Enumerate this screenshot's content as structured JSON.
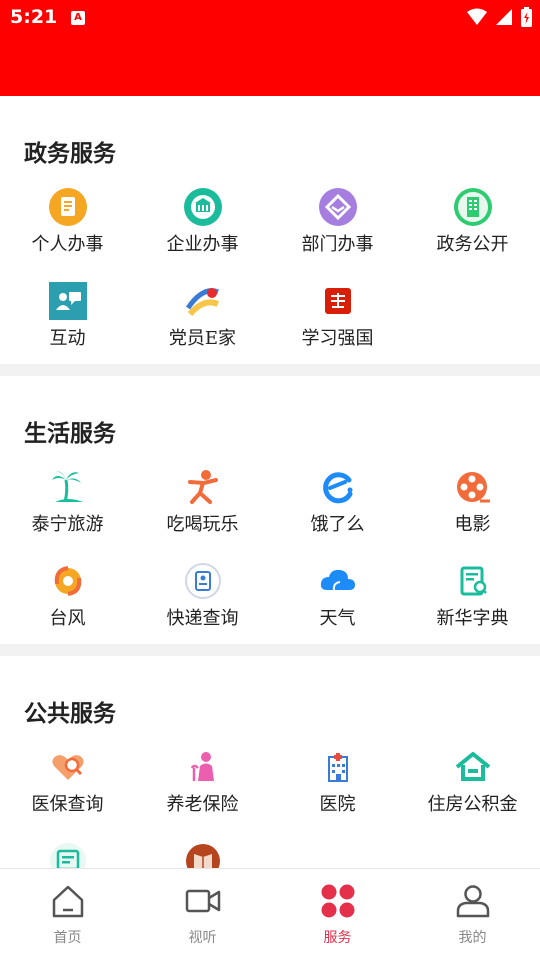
{
  "status_bar": {
    "time": "5:21",
    "app_badge": "A"
  },
  "sections": [
    {
      "title": "政务服务",
      "items": [
        {
          "label": "个人办事",
          "icon": "document-icon"
        },
        {
          "label": "企业办事",
          "icon": "building-icon"
        },
        {
          "label": "部门办事",
          "icon": "handshake-icon"
        },
        {
          "label": "政务公开",
          "icon": "office-building-icon"
        },
        {
          "label": "互动",
          "icon": "interaction-icon"
        },
        {
          "label": "党员E家",
          "icon": "party-member-icon"
        },
        {
          "label": "学习强国",
          "icon": "xuexi-qiangguo-icon"
        }
      ]
    },
    {
      "title": "生活服务",
      "items": [
        {
          "label": "泰宁旅游",
          "icon": "palm-tree-icon"
        },
        {
          "label": "吃喝玩乐",
          "icon": "person-running-icon"
        },
        {
          "label": "饿了么",
          "icon": "eleme-icon"
        },
        {
          "label": "电影",
          "icon": "film-reel-icon"
        },
        {
          "label": "台风",
          "icon": "typhoon-icon"
        },
        {
          "label": "快递查询",
          "icon": "express-icon"
        },
        {
          "label": "天气",
          "icon": "cloud-icon"
        },
        {
          "label": "新华字典",
          "icon": "dictionary-icon"
        }
      ]
    },
    {
      "title": "公共服务",
      "items": [
        {
          "label": "医保查询",
          "icon": "heart-search-icon"
        },
        {
          "label": "养老保险",
          "icon": "elderly-icon"
        },
        {
          "label": "医院",
          "icon": "hospital-icon"
        },
        {
          "label": "住房公积金",
          "icon": "house-icon"
        },
        {
          "label": "",
          "icon": "form-icon"
        },
        {
          "label": "",
          "icon": "book-icon"
        }
      ]
    }
  ],
  "tabbar": {
    "active": "服务",
    "items": [
      {
        "label": "首页",
        "icon": "home-icon"
      },
      {
        "label": "视听",
        "icon": "video-camera-icon"
      },
      {
        "label": "服务",
        "icon": "services-grid-icon"
      },
      {
        "label": "我的",
        "icon": "user-icon"
      }
    ]
  },
  "colors": {
    "header": "#ff0000",
    "tab_active": "#e5304c"
  }
}
